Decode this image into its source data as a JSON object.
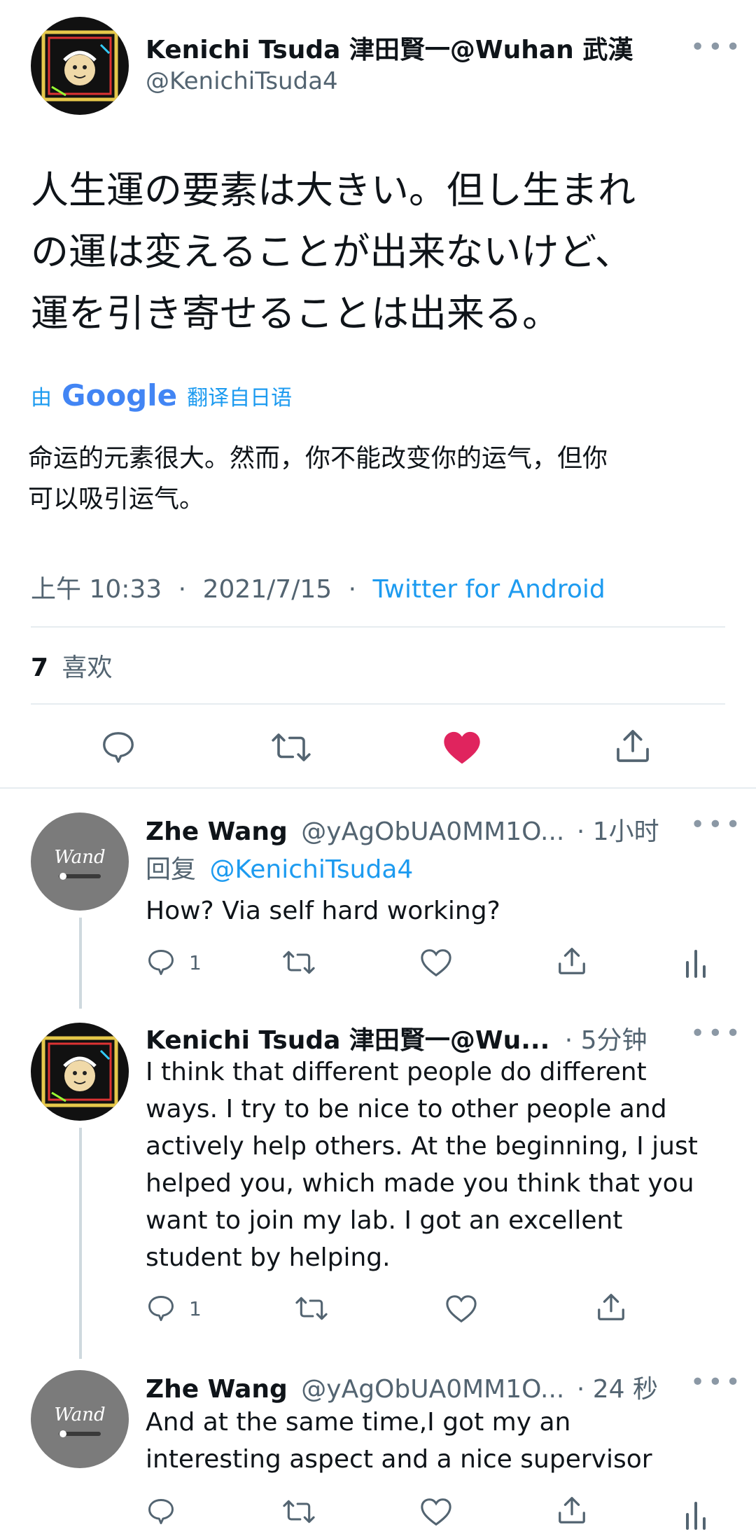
{
  "tweet": {
    "author_name": "Kenichi Tsuda 津田賢一@Wuhan 武漢",
    "handle": "@KenichiTsuda4",
    "text_lines": [
      "人生運の要素は大きい。但し生まれ",
      "の運は変えることが出来ないけど、",
      "運を引き寄せることは出来る。"
    ],
    "translation_by": "由",
    "translation_brand": "Google",
    "translation_from": "翻译自日语",
    "translation_lines": [
      "命运的元素很大。然而，你不能改变你的运气，但你",
      "可以吸引运气。"
    ],
    "time": "上午 10:33",
    "date": "2021/7/15",
    "dot": "·",
    "source": "Twitter for Android",
    "likes_count": "7",
    "likes_label": "喜欢",
    "liked": true
  },
  "replies": [
    {
      "name": "Zhe Wang",
      "handle": "@yAgObUA0MM1O...",
      "time": "· 1小时",
      "reply_prefix": "回复",
      "reply_to": "@KenichiTsuda4",
      "text_lines": [
        "How?  Via self hard working?"
      ],
      "reply_count": "1",
      "avatar_text": "Wand"
    },
    {
      "name": "Kenichi Tsuda 津田賢一@Wu...",
      "handle": "",
      "time": "· 5分钟",
      "text_lines": [
        "I think that different people do different",
        "ways. I try to be nice to other people and",
        "actively help others. At the beginning, I just",
        "helped you, which made you think that you",
        "want to join my lab. I got an excellent",
        "student by helping."
      ],
      "reply_count": "1"
    },
    {
      "name": "Zhe Wang",
      "handle": "@yAgObUA0MM1O...",
      "time": "· 24 秒",
      "text_lines": [
        "And at the same time,I got my an",
        "interesting aspect and a nice supervisor"
      ],
      "avatar_text": "Wand"
    }
  ],
  "more_glyph": "•••",
  "colors": {
    "accent": "#1d9bf0",
    "like": "#e0245e",
    "text": "#0f1419",
    "muted": "#536471"
  }
}
